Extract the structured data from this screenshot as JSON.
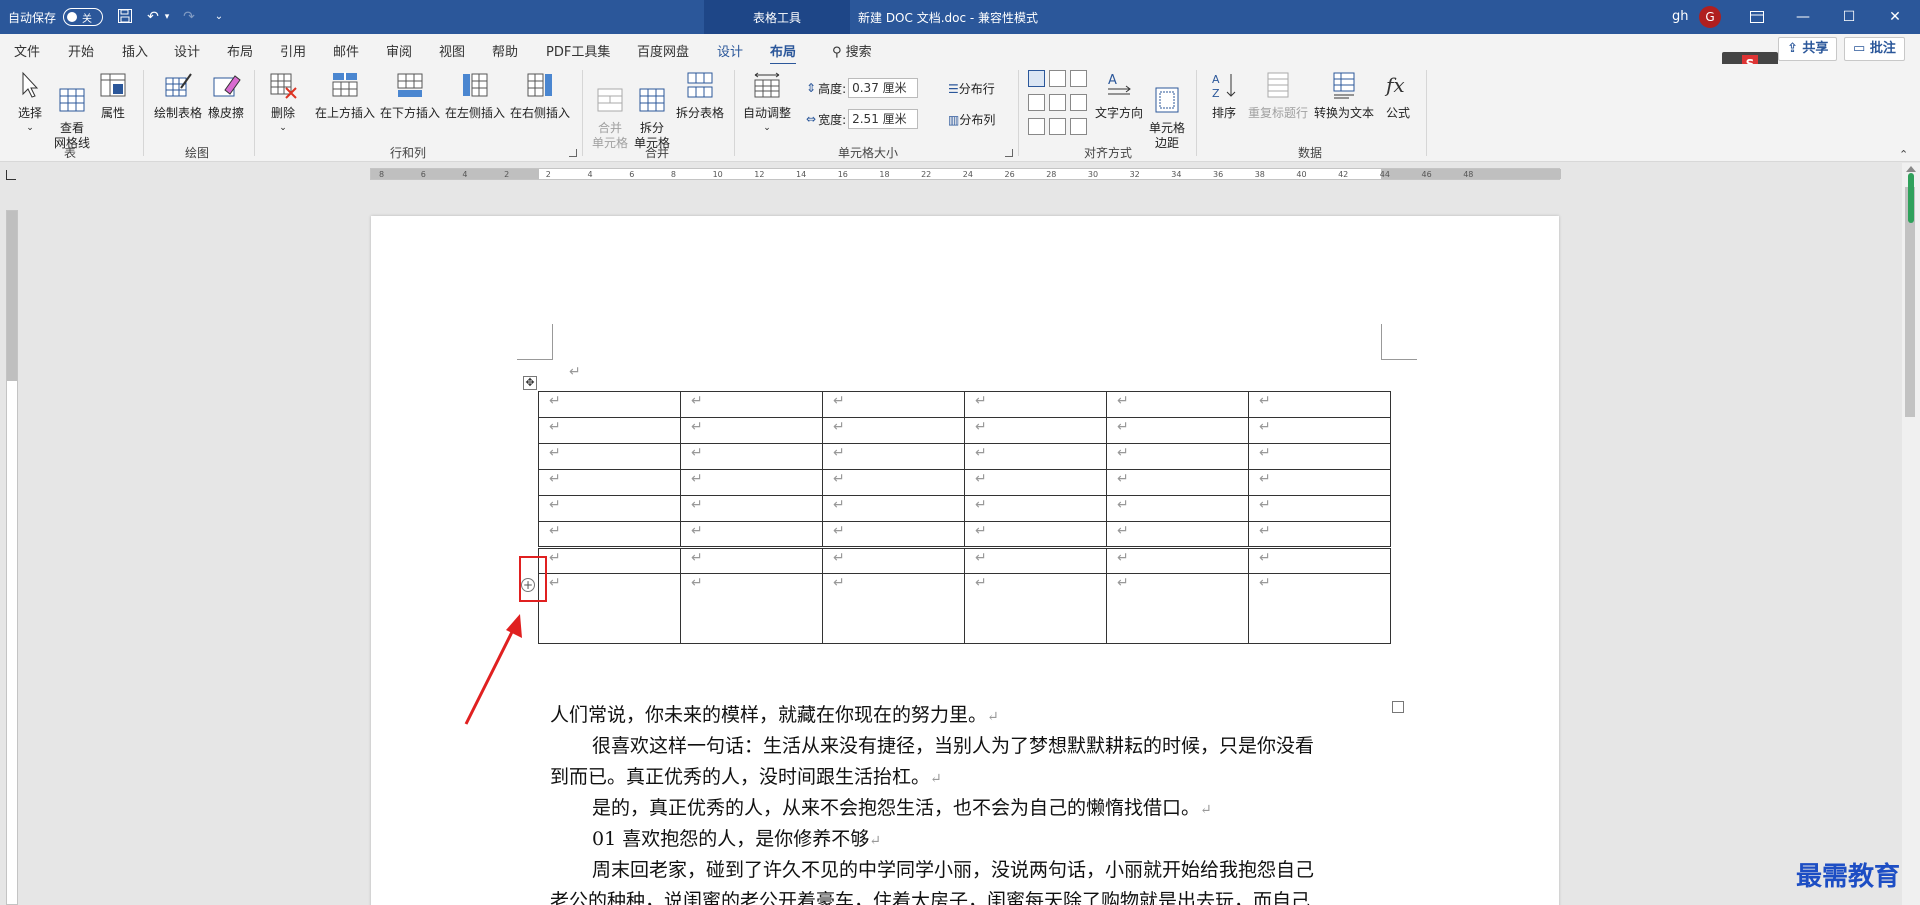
{
  "titlebar": {
    "autosave": "自动保存",
    "toggle": "关",
    "context_tab": "表格工具",
    "doc_title": "新建 DOC 文档.doc  -  兼容性模式",
    "user": "gh",
    "avatar": "G"
  },
  "menu": {
    "tabs": [
      "文件",
      "开始",
      "插入",
      "设计",
      "布局",
      "引用",
      "邮件",
      "审阅",
      "视图",
      "帮助",
      "PDF工具集",
      "百度网盘",
      "设计",
      "布局"
    ],
    "search": "搜索",
    "share": "共享",
    "comment": "批注"
  },
  "ribbon": {
    "groups": {
      "table": "表",
      "draw": "绘图",
      "rows_cols": "行和列",
      "merge": "合并",
      "cell_size": "单元格大小",
      "align": "对齐方式",
      "data": "数据"
    },
    "buttons": {
      "select": "选择",
      "gridlines": "查看\n网格线",
      "props": "属性",
      "draw_table": "绘制表格",
      "eraser": "橡皮擦",
      "delete": "删除",
      "insert_above": "在上方插入",
      "insert_below": "在下方插入",
      "insert_left": "在左侧插入",
      "insert_right": "在右侧插入",
      "merge_cells": "合并\n单元格",
      "split_cells": "拆分\n单元格",
      "split_table": "拆分表格",
      "autofit": "自动调整",
      "height_label": "高度:",
      "height_value": "0.37 厘米",
      "width_label": "宽度:",
      "width_value": "2.51 厘米",
      "dist_rows": "分布行",
      "dist_cols": "分布列",
      "text_dir": "文字方向",
      "cell_margins": "单元格\n边距",
      "sort": "排序",
      "repeat_header": "重复标题行",
      "to_text": "转换为文本",
      "formula": "公式"
    }
  },
  "ruler_ticks": [
    "8",
    "6",
    "4",
    "2",
    "2",
    "4",
    "6",
    "8",
    "10",
    "12",
    "14",
    "16",
    "18",
    "22",
    "24",
    "26",
    "28",
    "30",
    "32",
    "34",
    "36",
    "38",
    "40",
    "42",
    "44",
    "46",
    "48"
  ],
  "document": {
    "table": {
      "rows": 8,
      "cols": 6,
      "cell_mark": "↵"
    },
    "paragraphs": [
      "人们常说，你未来的模样，就藏在你现在的努力里。",
      "很喜欢这样一句话：生活从来没有捷径，当别人为了梦想默默耕耘的时候，只是你没看",
      "到而已。真正优秀的人，没时间跟生活抬杠。",
      "是的，真正优秀的人，从来不会抱怨生活，也不会为自己的懒惰找借口。",
      "01  喜欢抱怨的人，是你修养不够",
      "周末回老家，碰到了许久不见的中学同学小丽，没说两句话，小丽就开始给我抱怨自己",
      "老公的种种，说闺蜜的老公开着豪车，住着大房子，闺蜜每天除了购物就是出去玩，而自己"
    ],
    "para_mark": "↵"
  },
  "watermark": "最需教育",
  "colors": {
    "accent": "#2b579a",
    "highlight": "#e02020"
  }
}
